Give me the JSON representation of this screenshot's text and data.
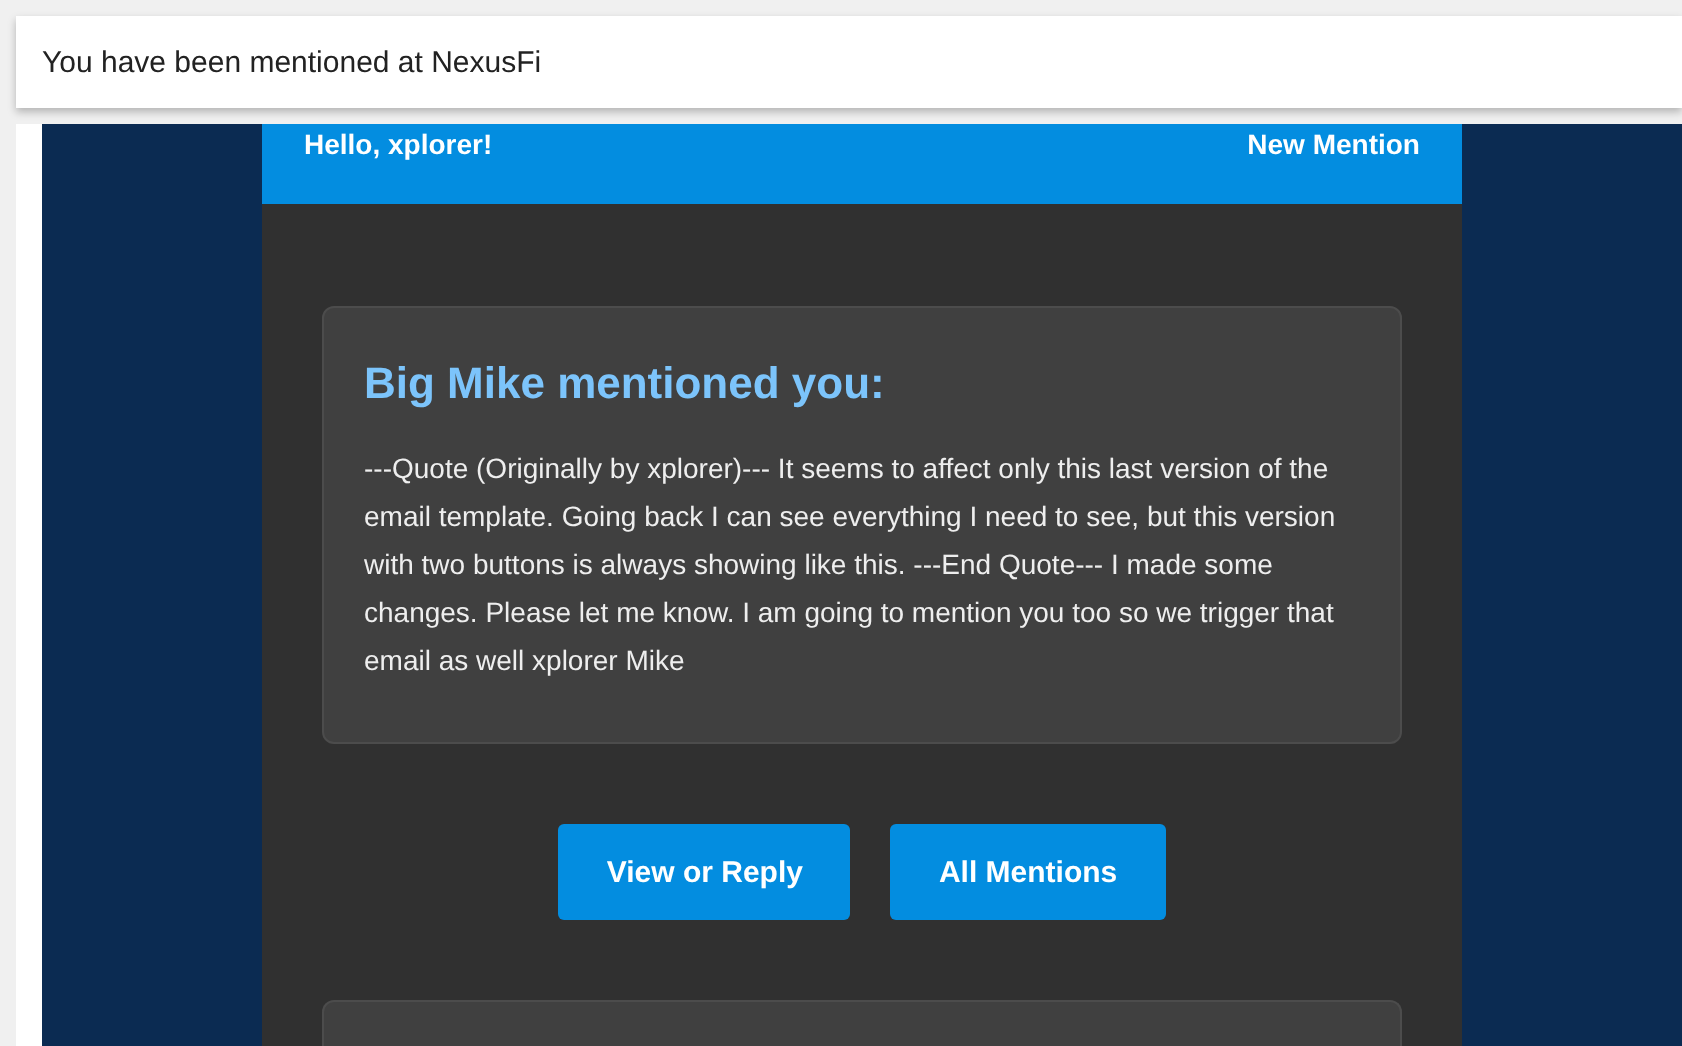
{
  "subject": "You have been mentioned at NexusFi",
  "email_header": {
    "greeting": "Hello, xplorer!",
    "label": "New Mention"
  },
  "mention_card": {
    "title": "Big Mike mentioned you:",
    "body": "---Quote (Originally by xplorer)--- It seems to affect only this last version of the email template. Going back I can see everything I need to see, but this version with two buttons is always showing like this. ---End Quote--- I made some changes. Please let me know. I am going to mention you too so we trigger that email as well xplorer Mike"
  },
  "buttons": [
    {
      "label": "View or Reply"
    },
    {
      "label": "All Mentions"
    }
  ]
}
